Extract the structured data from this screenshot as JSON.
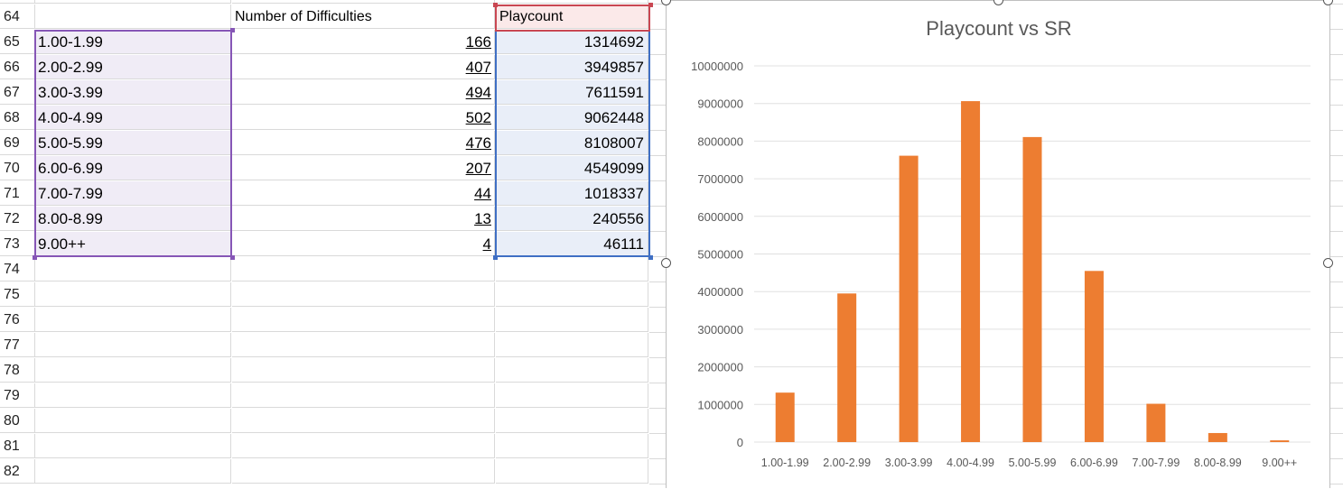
{
  "sheet": {
    "header_row_number": "64",
    "header_b": "Number of Difficulties",
    "header_c": "Playcount",
    "rows": [
      {
        "num": "65",
        "range": "1.00-1.99",
        "difficulties": "166",
        "playcount": "1314692"
      },
      {
        "num": "66",
        "range": "2.00-2.99",
        "difficulties": "407",
        "playcount": "3949857"
      },
      {
        "num": "67",
        "range": "3.00-3.99",
        "difficulties": "494",
        "playcount": "7611591"
      },
      {
        "num": "68",
        "range": "4.00-4.99",
        "difficulties": "502",
        "playcount": "9062448"
      },
      {
        "num": "69",
        "range": "5.00-5.99",
        "difficulties": "476",
        "playcount": "8108007"
      },
      {
        "num": "70",
        "range": "6.00-6.99",
        "difficulties": "207",
        "playcount": "4549099"
      },
      {
        "num": "71",
        "range": "7.00-7.99",
        "difficulties": "44",
        "playcount": "1018337"
      },
      {
        "num": "72",
        "range": "8.00-8.99",
        "difficulties": "13",
        "playcount": "240556"
      },
      {
        "num": "73",
        "range": "9.00++",
        "difficulties": "4",
        "playcount": "46111"
      }
    ],
    "empty_rows": [
      "74",
      "75",
      "76",
      "77",
      "78",
      "79",
      "80",
      "81",
      "82"
    ]
  },
  "colors": {
    "bar": "#ed7d31",
    "selection_a": "#8656b6",
    "selection_c": "#3f6fc4",
    "selection_header": "#c94752",
    "gridline": "#d9d9d9"
  },
  "chart_data": {
    "type": "bar",
    "title": "Playcount vs SR",
    "categories": [
      "1.00-1.99",
      "2.00-2.99",
      "3.00-3.99",
      "4.00-4.99",
      "5.00-5.99",
      "6.00-6.99",
      "7.00-7.99",
      "8.00-8.99",
      "9.00++"
    ],
    "values": [
      1314692,
      3949857,
      7611591,
      9062448,
      8108007,
      4549099,
      1018337,
      240556,
      46111
    ],
    "ylim": [
      0,
      10000000
    ],
    "yticks": [
      "0",
      "1000000",
      "2000000",
      "3000000",
      "4000000",
      "5000000",
      "6000000",
      "7000000",
      "8000000",
      "9000000",
      "10000000"
    ],
    "grid": true,
    "xlabel": "",
    "ylabel": ""
  }
}
